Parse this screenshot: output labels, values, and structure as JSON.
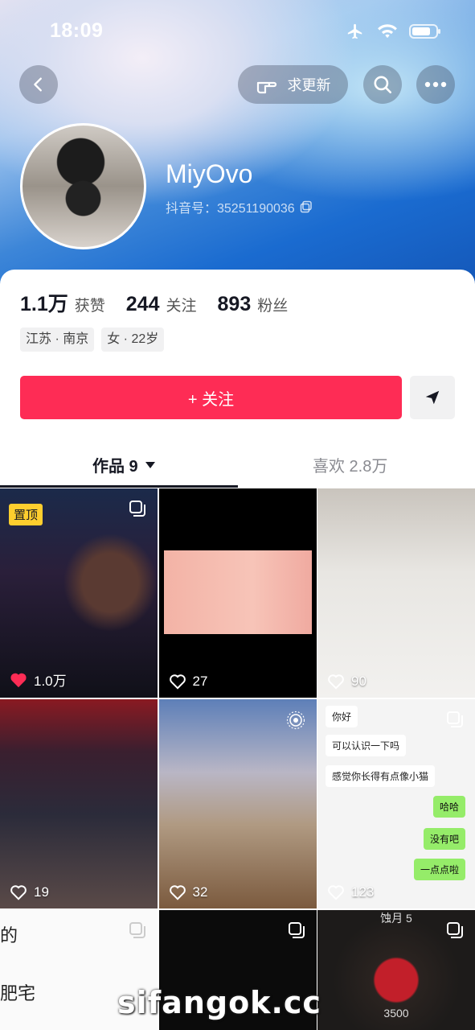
{
  "status": {
    "time": "18:09"
  },
  "topbar": {
    "request_update_label": "求更新"
  },
  "profile": {
    "username": "MiyOvo",
    "douyin_id": "抖音号：35251190036",
    "stats": [
      {
        "value": "1.1万",
        "label": "获赞"
      },
      {
        "value": "244",
        "label": "关注"
      },
      {
        "value": "893",
        "label": "粉丝"
      }
    ],
    "tags": [
      "江苏 · 南京",
      "女 · 22岁"
    ],
    "follow_label": "+ 关注"
  },
  "tabs": {
    "works": "作品 9",
    "likes": "喜欢 2.8万"
  },
  "grid": {
    "pinned": "置顶",
    "items": [
      {
        "likes": "1.0万"
      },
      {
        "likes": "27"
      },
      {
        "likes": "90"
      },
      {
        "likes": "19"
      },
      {
        "likes": "32"
      },
      {
        "likes": "123"
      }
    ],
    "chat": [
      "你好",
      "可以认识一下吗",
      "感觉你长得有点像小猫",
      "哈哈",
      "没有吧",
      "一点点啦"
    ],
    "cell7_text": [
      "的",
      "肥宅"
    ],
    "cell9_top": "蚀月 5",
    "cell9_bottom": "3500"
  },
  "watermark": "sifangok.cc",
  "colors": {
    "accent": "#fe2c55",
    "pinned": "#fece2e"
  }
}
